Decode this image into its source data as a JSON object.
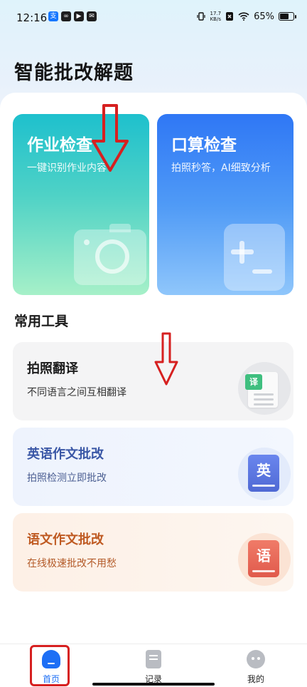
{
  "status_bar": {
    "time": "12:16",
    "net_speed_value": "17.7",
    "net_speed_unit": "KB/s",
    "battery": "65%"
  },
  "page_title": "智能批改解题",
  "feature_cards": [
    {
      "title": "作业检查",
      "subtitle": "一键识别作业内容",
      "icon": "camera-icon"
    },
    {
      "title": "口算检查",
      "subtitle": "拍照秒答，AI细致分析",
      "icon": "calculator-icon"
    }
  ],
  "tools_section_title": "常用工具",
  "tools": [
    {
      "title": "拍照翻译",
      "subtitle": "不同语言之间互相翻译",
      "icon_char": "译",
      "color": "#3fbf7f"
    },
    {
      "title": "英语作文批改",
      "subtitle": "拍照检测立即批改",
      "icon_char": "英",
      "color": "#4f69d4"
    },
    {
      "title": "语文作文批改",
      "subtitle": "在线极速批改不用愁",
      "icon_char": "语",
      "color": "#e05a4c"
    }
  ],
  "bottom_nav": [
    {
      "label": "首页",
      "active": true
    },
    {
      "label": "记录",
      "active": false
    },
    {
      "label": "我的",
      "active": false
    }
  ],
  "colors": {
    "accent": "#1e6ff5",
    "annotation_red": "#d62020"
  }
}
